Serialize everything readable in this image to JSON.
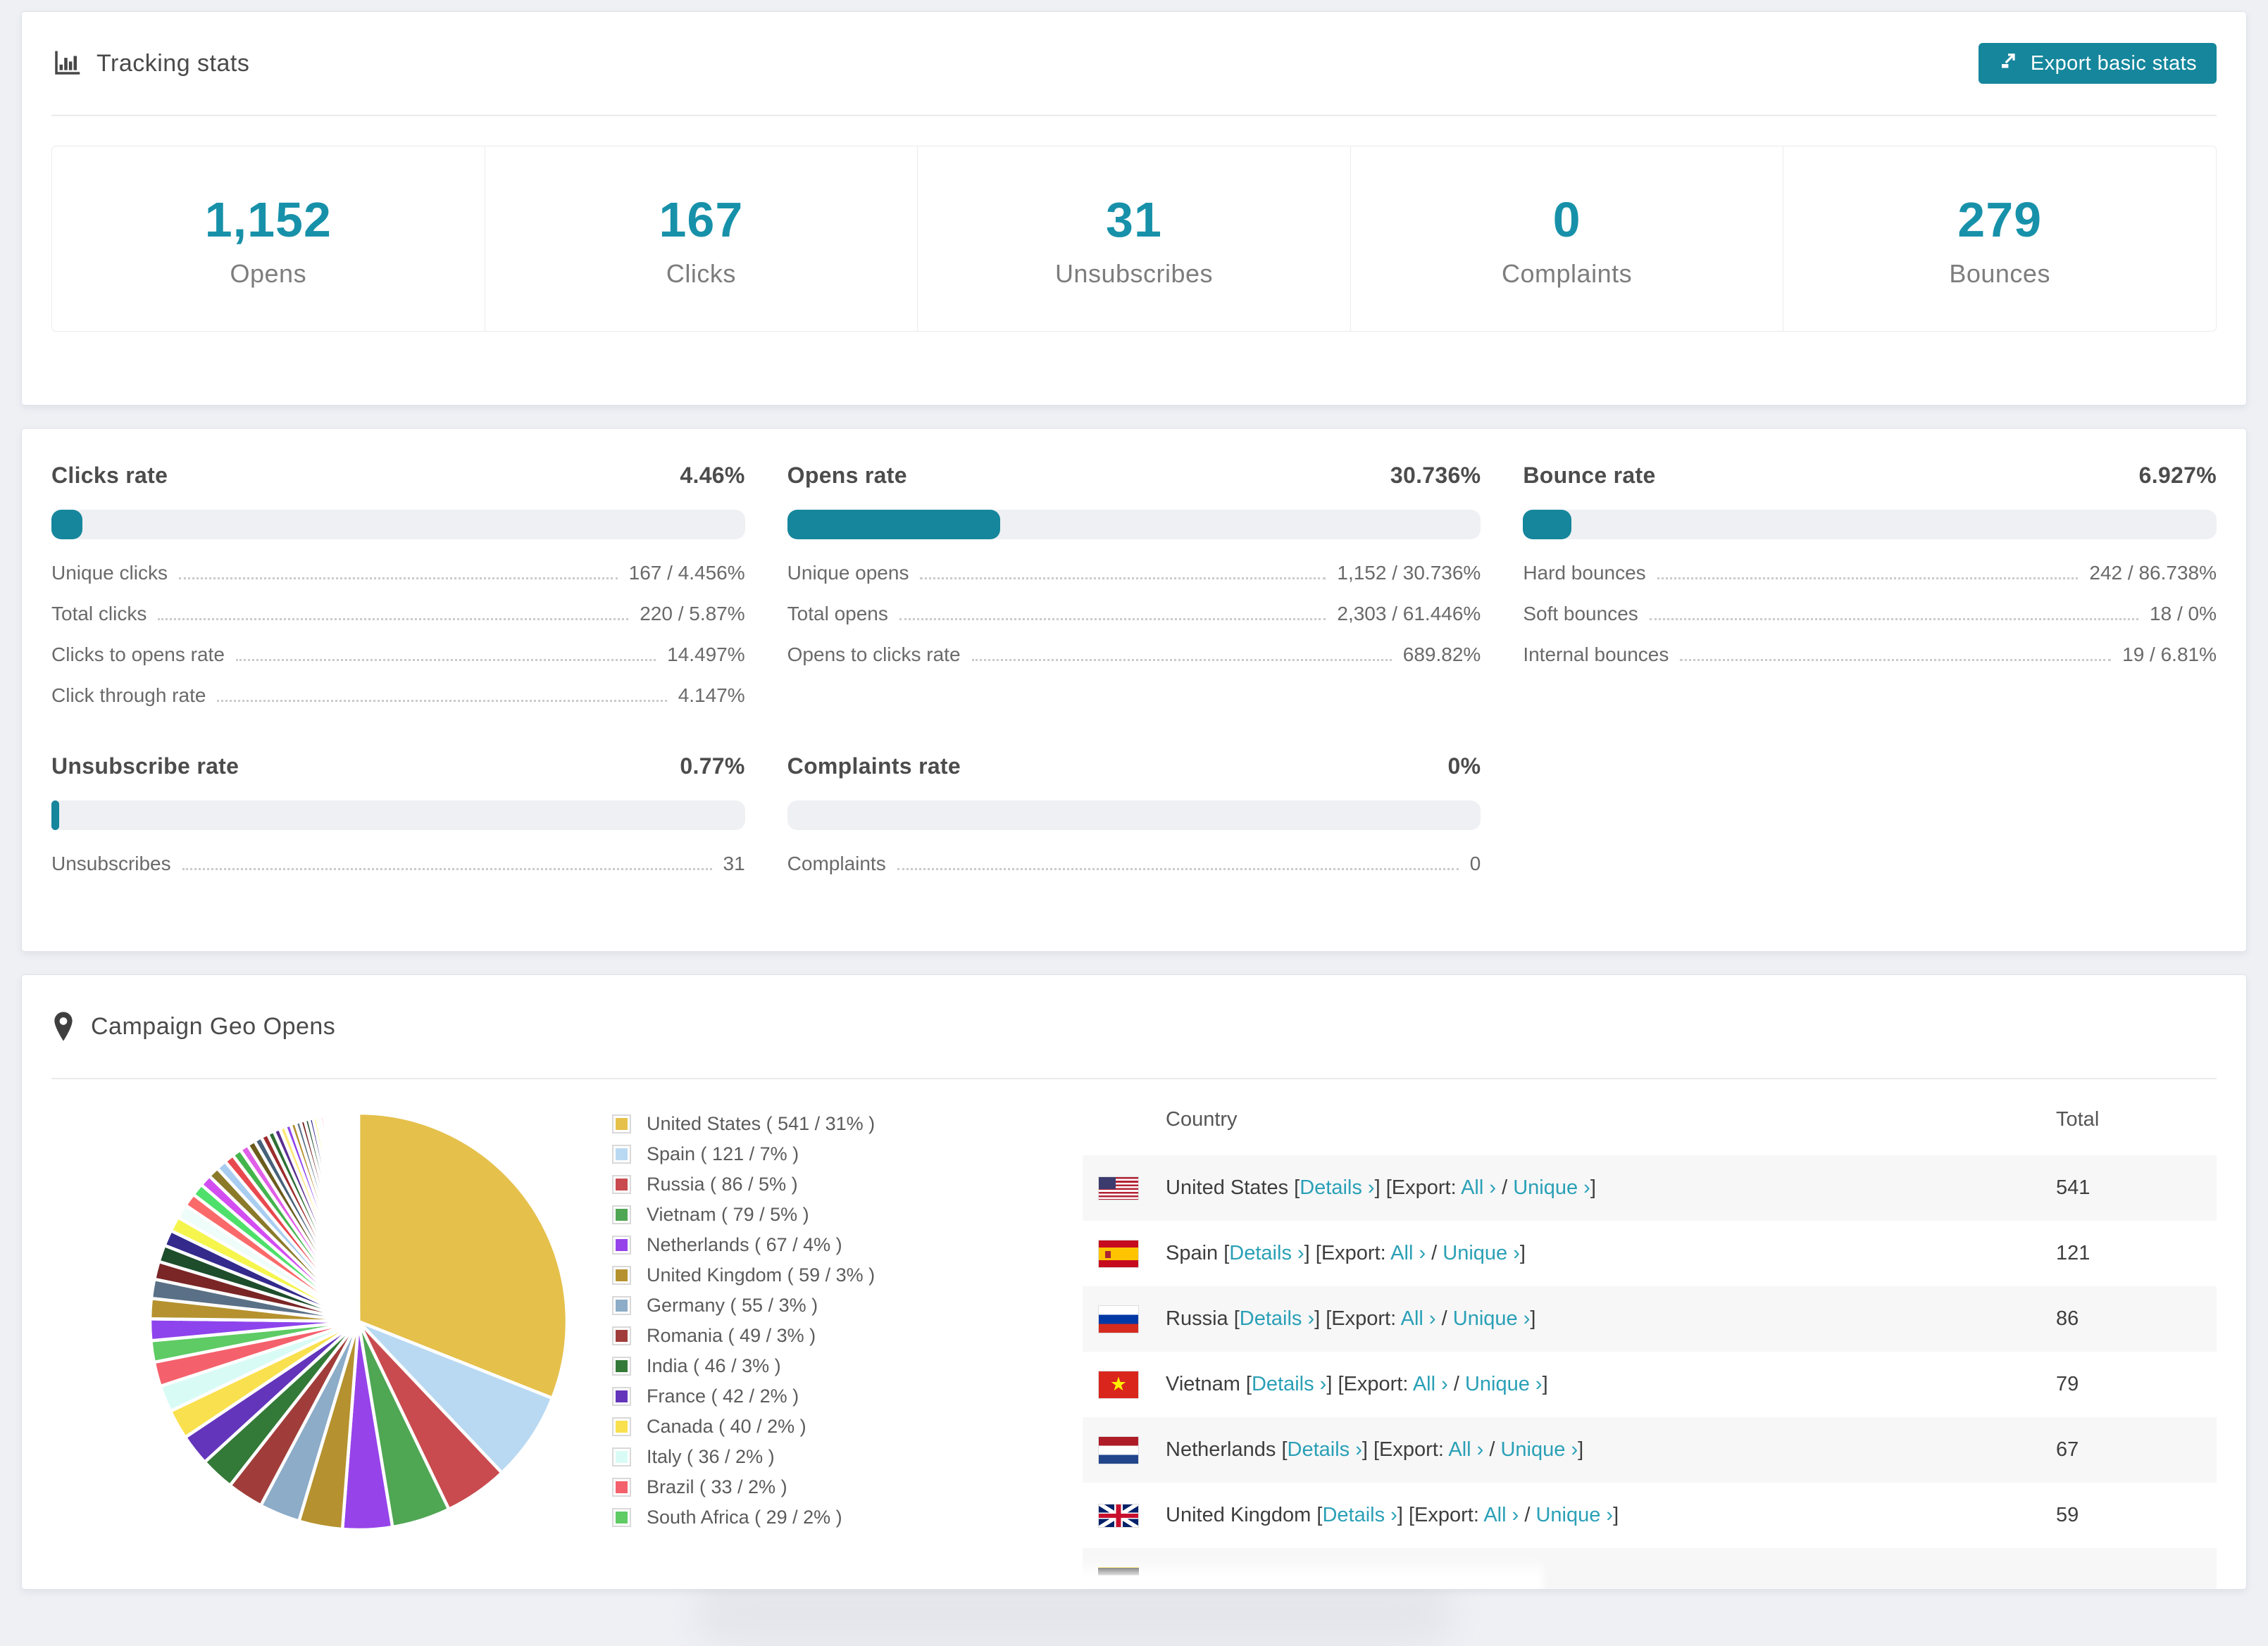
{
  "colors": {
    "accent": "#15869c",
    "link": "#2aa0b6",
    "number": "#1791a9"
  },
  "tracking": {
    "title": "Tracking stats",
    "export_label": "Export basic stats",
    "stats": [
      {
        "value": "1,152",
        "label": "Opens"
      },
      {
        "value": "167",
        "label": "Clicks"
      },
      {
        "value": "31",
        "label": "Unsubscribes"
      },
      {
        "value": "0",
        "label": "Complaints"
      },
      {
        "value": "279",
        "label": "Bounces"
      }
    ]
  },
  "rates": [
    {
      "title": "Clicks rate",
      "value": "4.46%",
      "percent": 4.46,
      "rows": [
        {
          "label": "Unique clicks",
          "value": "167 / 4.456%"
        },
        {
          "label": "Total clicks",
          "value": "220 / 5.87%"
        },
        {
          "label": "Clicks to opens rate",
          "value": "14.497%"
        },
        {
          "label": "Click through rate",
          "value": "4.147%"
        }
      ]
    },
    {
      "title": "Opens rate",
      "value": "30.736%",
      "percent": 30.736,
      "rows": [
        {
          "label": "Unique opens",
          "value": "1,152 / 30.736%"
        },
        {
          "label": "Total opens",
          "value": "2,303 / 61.446%"
        },
        {
          "label": "Opens to clicks rate",
          "value": "689.82%"
        }
      ]
    },
    {
      "title": "Bounce rate",
      "value": "6.927%",
      "percent": 6.927,
      "rows": [
        {
          "label": "Hard bounces",
          "value": "242 / 86.738%"
        },
        {
          "label": "Soft bounces",
          "value": "18 / 0%"
        },
        {
          "label": "Internal bounces",
          "value": "19 / 6.81%"
        }
      ]
    },
    {
      "title": "Unsubscribe rate",
      "value": "0.77%",
      "percent": 0.77,
      "rows": [
        {
          "label": "Unsubscribes",
          "value": "31"
        }
      ]
    },
    {
      "title": "Complaints rate",
      "value": "0%",
      "percent": 0,
      "rows": [
        {
          "label": "Complaints",
          "value": "0"
        }
      ]
    }
  ],
  "geo": {
    "title": "Campaign Geo Opens",
    "headers": {
      "country": "Country",
      "total": "Total"
    },
    "links": {
      "open": "[",
      "details": "Details ›",
      "close": "]",
      "export_prefix": "[Export:",
      "all": "All ›",
      "slash": "/",
      "unique": "Unique ›"
    },
    "rows": [
      {
        "country": "United States",
        "flag": "us",
        "total": "541"
      },
      {
        "country": "Spain",
        "flag": "es",
        "total": "121"
      },
      {
        "country": "Russia",
        "flag": "ru",
        "total": "86"
      },
      {
        "country": "Vietnam",
        "flag": "vn",
        "total": "79"
      },
      {
        "country": "Netherlands",
        "flag": "nl",
        "total": "67"
      },
      {
        "country": "United Kingdom",
        "flag": "gb",
        "total": "59"
      },
      {
        "country": "Germany",
        "flag": "de",
        "total": "",
        "partial": true
      }
    ]
  },
  "chart_data": {
    "type": "pie",
    "title": "Campaign Geo Opens",
    "legend_position": "right",
    "start_angle_deg": 0,
    "direction": "clockwise",
    "labels": [
      "United States",
      "Spain",
      "Russia",
      "Vietnam",
      "Netherlands",
      "United Kingdom",
      "Germany",
      "Romania",
      "India",
      "France",
      "Canada",
      "Italy",
      "Brazil",
      "South Africa"
    ],
    "values": [
      541,
      121,
      86,
      79,
      67,
      59,
      55,
      49,
      46,
      42,
      40,
      36,
      33,
      29
    ],
    "percents": [
      31,
      7,
      5,
      5,
      4,
      3,
      3,
      3,
      3,
      2,
      2,
      2,
      2,
      2
    ],
    "colors": [
      "#e5c04b",
      "#b9d9f2",
      "#c94b4f",
      "#4fa653",
      "#9643ea",
      "#b5922f",
      "#8cacc8",
      "#a03d3a",
      "#337a38",
      "#6335bb",
      "#f9e04e",
      "#d9fbf6",
      "#f4616c",
      "#5ecb64"
    ],
    "others": {
      "total": 462,
      "slice_count": 48,
      "decay": 0.94,
      "palette": [
        "#8e44ec",
        "#b5922f",
        "#5a7086",
        "#7a2626",
        "#1d4d2b",
        "#332a8c",
        "#f5f54d",
        "#eefcfa",
        "#fa6a6a",
        "#4ee06a",
        "#d24ef0",
        "#8a7a2a",
        "#a8cdf0",
        "#e8494f",
        "#44b44c",
        "#e060e8",
        "#6b5b1d",
        "#47617a",
        "#9c2d2d",
        "#2f6e34",
        "#5b2d91",
        "#ffe97a"
      ]
    },
    "legend_format": "{label} ( {value} / {percent}% )"
  }
}
